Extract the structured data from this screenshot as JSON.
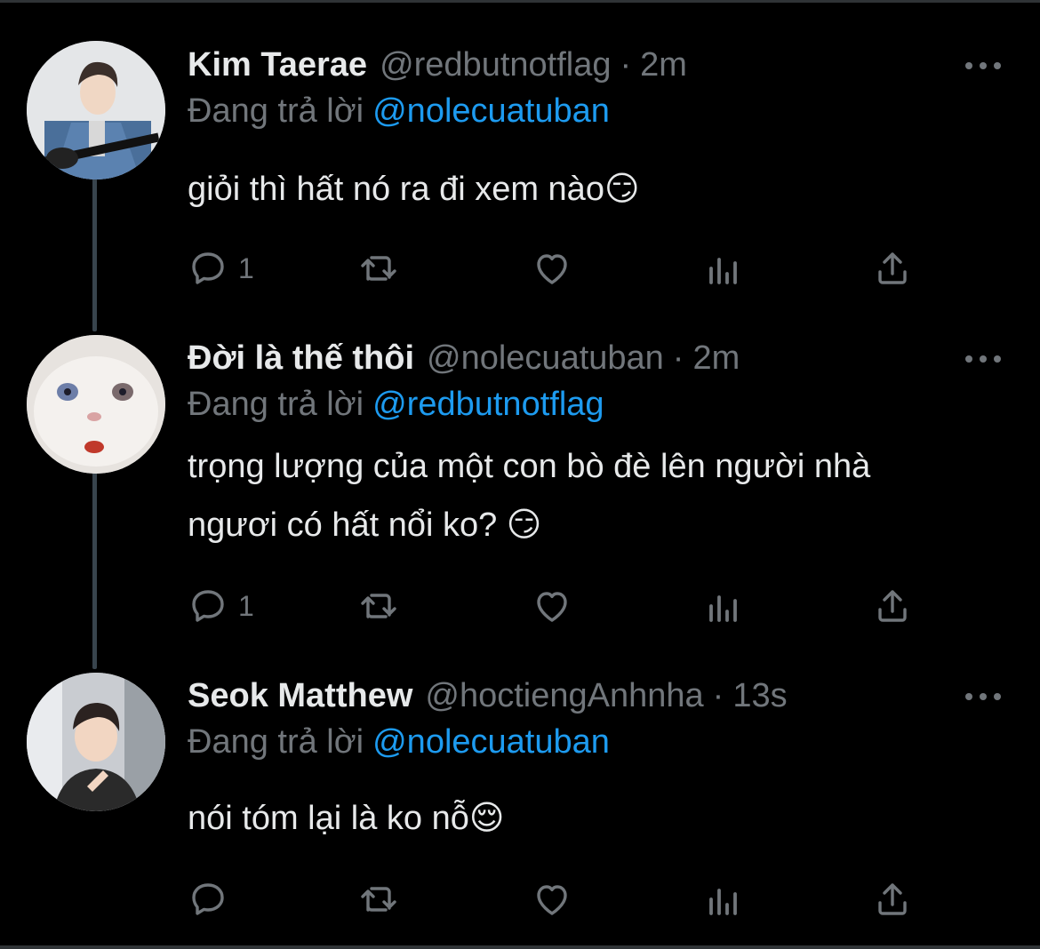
{
  "tweets": [
    {
      "name": "Kim Taerae",
      "handle": "@redbutnotflag",
      "separator": "·",
      "time": "2m",
      "replying_prefix": "Đang trả lời",
      "replying_to": "@nolecuatuban",
      "text": "giỏi thì hất nó ra đi xem nào😏",
      "reply_count": "1",
      "retweet_count": "",
      "like_count": ""
    },
    {
      "name": "Đời là thế thôi",
      "handle": "@nolecuatuban",
      "separator": "·",
      "time": "2m",
      "replying_prefix": "Đang trả lời",
      "replying_to": "@redbutnotflag",
      "text_lines": [
        "trọng lượng của một con bò đè lên người nhà",
        "ngươi có hất nổi ko? 😏"
      ],
      "reply_count": "1",
      "retweet_count": "",
      "like_count": ""
    },
    {
      "name": "Seok Matthew",
      "handle": "@hoctiengAnhnha",
      "separator": "·",
      "time": "13s",
      "replying_prefix": "Đang trả lời",
      "replying_to": "@nolecuatuban",
      "text": "nói tóm lại là ko nỗ😌",
      "reply_count": "",
      "retweet_count": "",
      "like_count": ""
    }
  ],
  "icons": {
    "reply": "reply-icon",
    "retweet": "retweet-icon",
    "like": "heart-icon",
    "views": "analytics-icon",
    "share": "share-icon",
    "more": "more-icon"
  },
  "colors": {
    "background": "#000000",
    "text": "#e7e9ea",
    "secondary": "#71767b",
    "accent": "#1d9bf0"
  }
}
